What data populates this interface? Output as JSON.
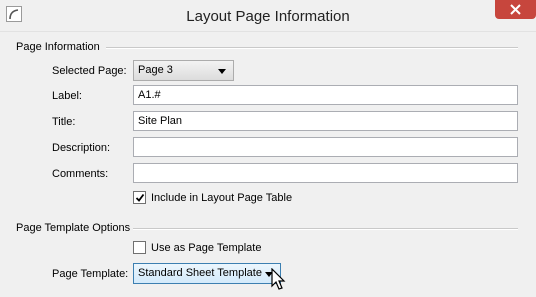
{
  "window": {
    "title": "Layout Page Information",
    "close_icon": "close-icon",
    "app_icon": "app-icon"
  },
  "page_info": {
    "group_label": "Page Information",
    "selected_page_label": "Selected Page:",
    "selected_page_value": "Page 3",
    "label_label": "Label:",
    "label_value": "A1.#",
    "title_label": "Title:",
    "title_value": "Site Plan",
    "description_label": "Description:",
    "description_value": "",
    "comments_label": "Comments:",
    "comments_value": "",
    "include_label": "Include in Layout Page Table",
    "include_checked": true
  },
  "template_options": {
    "group_label": "Page Template Options",
    "use_as_template_label": "Use as Page Template",
    "use_as_template_checked": false,
    "page_template_label": "Page Template:",
    "page_template_value": "Standard Sheet Template"
  },
  "colors": {
    "close_button": "#c7463d",
    "hover_border": "#3c7fb1"
  }
}
